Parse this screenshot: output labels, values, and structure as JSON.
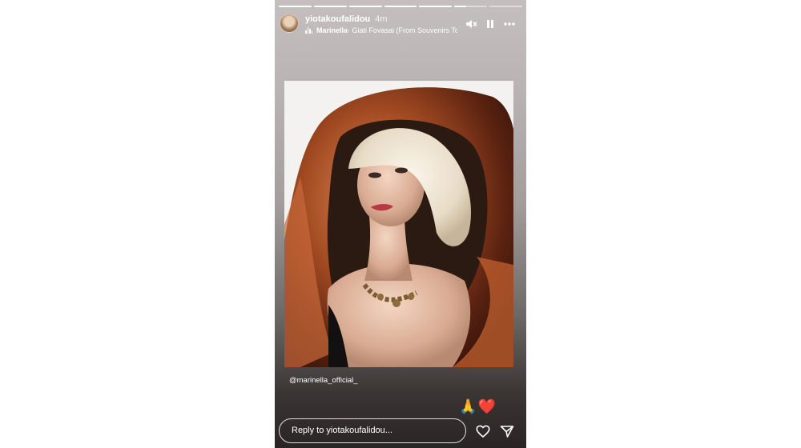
{
  "story": {
    "progress_segments": [
      1,
      1,
      1,
      1,
      1,
      0.35,
      0
    ],
    "user": {
      "name": "yiotakoufalidou",
      "time": "4m"
    },
    "music": {
      "artist": "Marinella",
      "track": " · Giati Fovasai (From Souvenirs To Sa"
    },
    "controls": {
      "mute_icon": "speaker-muted-icon",
      "pause_icon": "pause-icon",
      "more_icon": "more-horizontal-icon"
    },
    "caption": "@marinella_official_",
    "reactions": "🙏❤️",
    "reply": {
      "placeholder": "Reply to yiotakoufalidou..."
    },
    "icons": {
      "heart": "heart-outline-icon",
      "send": "paper-plane-icon"
    }
  }
}
